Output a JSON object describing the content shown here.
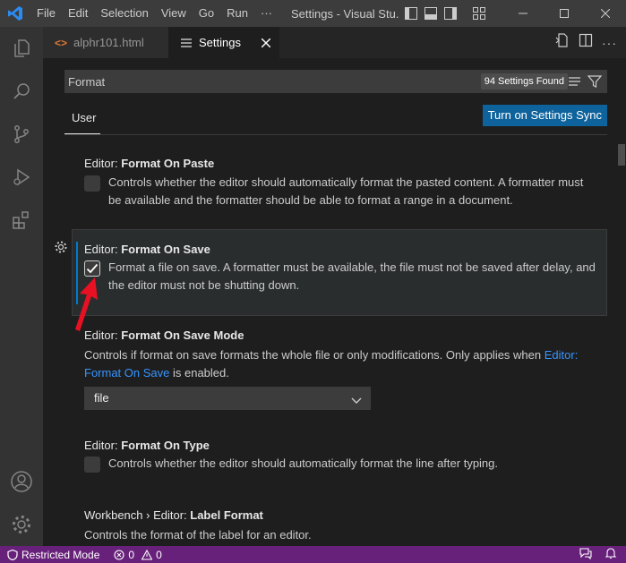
{
  "titlebar": {
    "menu": [
      "File",
      "Edit",
      "Selection",
      "View",
      "Go",
      "Run",
      "···"
    ],
    "title": "Settings - Visual Stu..."
  },
  "tabs": [
    {
      "label": "alphr101.html",
      "icon": "html-file-icon"
    },
    {
      "label": "Settings",
      "icon": "settings-tab-icon",
      "active": true
    }
  ],
  "search": {
    "value": "Format",
    "count": "94 Settings Found"
  },
  "scope": {
    "user_tab": "User",
    "sync_button": "Turn on Settings Sync"
  },
  "settings": [
    {
      "category": "Editor: ",
      "key": "Format On Paste",
      "description": "Controls whether the editor should automatically format the pasted content. A formatter must be available and the formatter should be able to format a range in a document.",
      "checked": false
    },
    {
      "category": "Editor: ",
      "key": "Format On Save",
      "description": "Format a file on save. A formatter must be available, the file must not be saved after delay, and the editor must not be shutting down.",
      "checked": true
    },
    {
      "category": "Editor: ",
      "key": "Format On Save Mode",
      "description_pre": "Controls if format on save formats the whole file or only modifications. Only applies when ",
      "link": "Editor: Format On Save",
      "description_post": " is enabled.",
      "select_value": "file"
    },
    {
      "category": "Editor: ",
      "key": "Format On Type",
      "description": "Controls whether the editor should automatically format the line after typing.",
      "checked": false
    },
    {
      "category": "Workbench › Editor: ",
      "key": "Label Format",
      "description": "Controls the format of the label for an editor."
    }
  ],
  "statusbar": {
    "restricted": "Restricted Mode",
    "errors": "0",
    "warnings": "0"
  },
  "colors": {
    "accent": "#007acc",
    "statusbar": "#68217a",
    "button": "#0e639c",
    "annotation_arrow": "#e81123"
  }
}
